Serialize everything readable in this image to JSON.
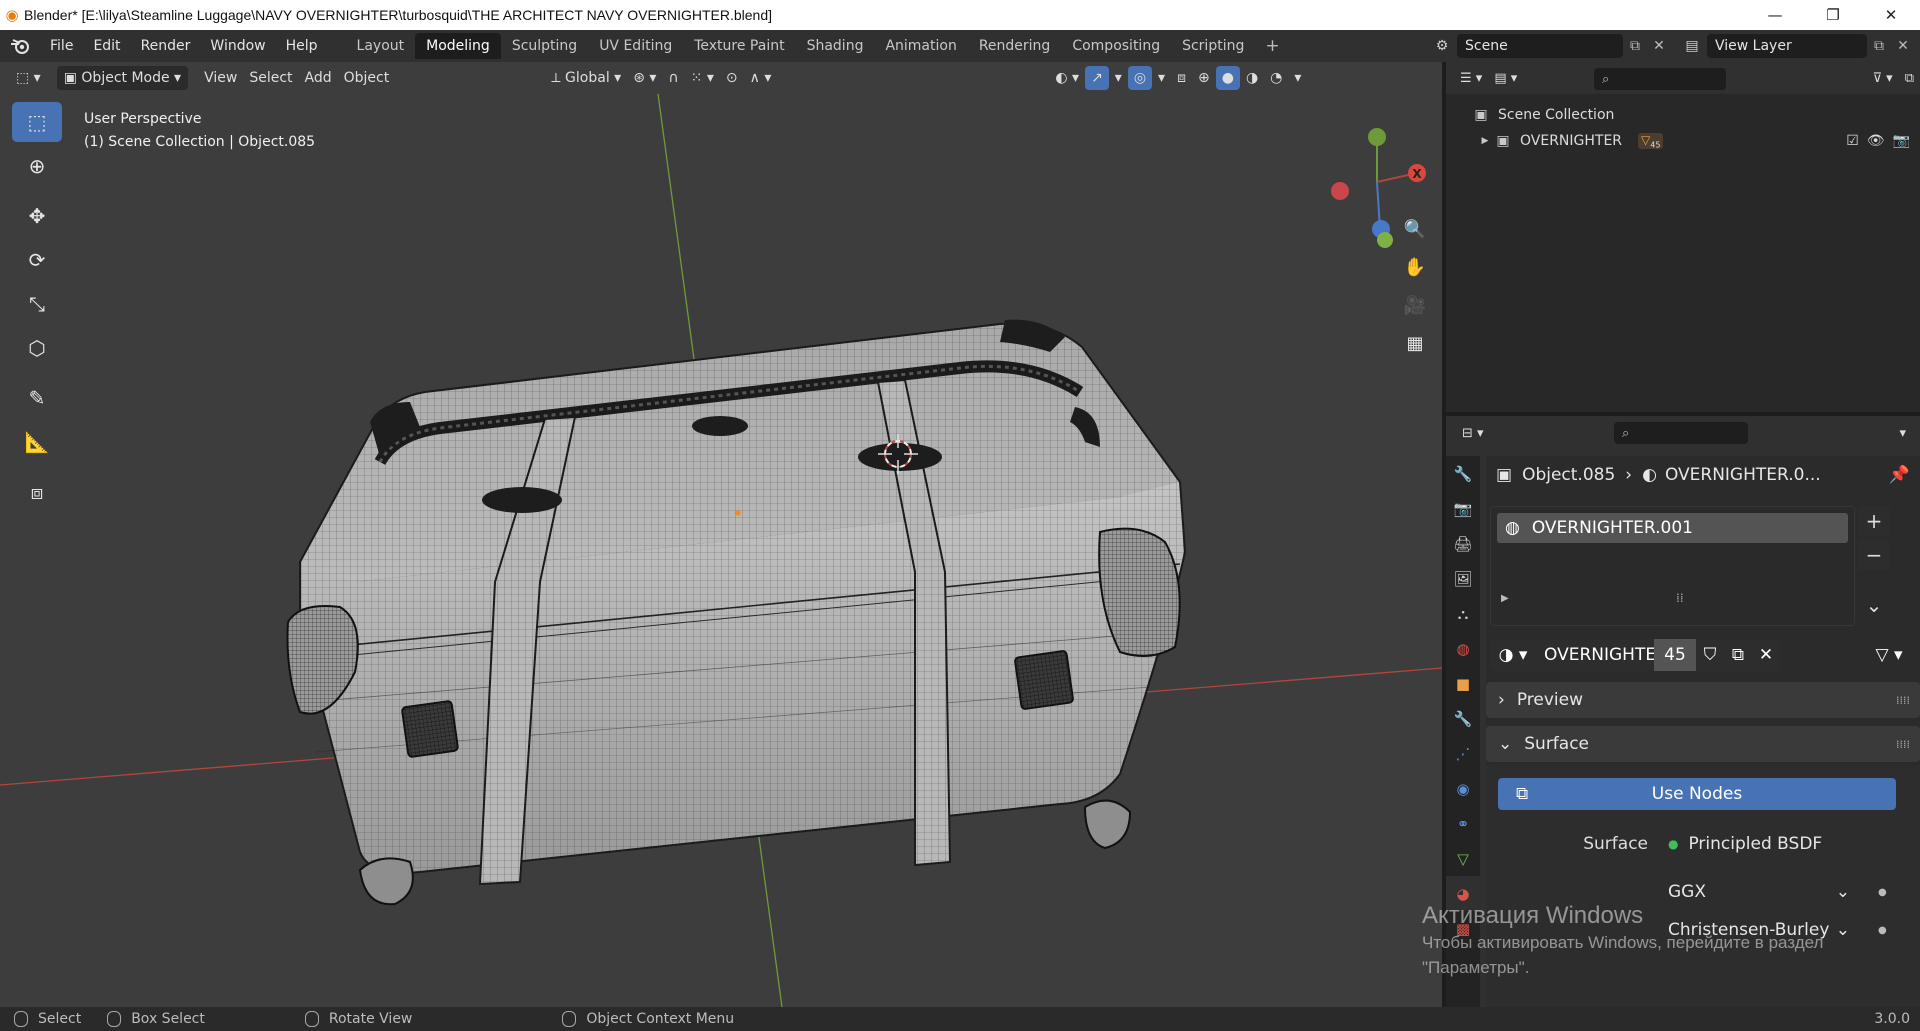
{
  "title_bar": {
    "title": "Blender* [E:\\lilya\\Steamline Luggage\\NAVY OVERNIGHTER\\turbosquid\\THE ARCHITECT NAVY OVERNIGHTER.blend]",
    "minimize": "—",
    "maximize": "❐",
    "close": "✕"
  },
  "menu": {
    "items": [
      "File",
      "Edit",
      "Render",
      "Window",
      "Help"
    ],
    "workspaces": [
      "Layout",
      "Modeling",
      "Sculpting",
      "UV Editing",
      "Texture Paint",
      "Shading",
      "Animation",
      "Rendering",
      "Compositing",
      "Scripting"
    ],
    "active_workspace": "Modeling",
    "add_workspace": "+",
    "scene": "Scene",
    "view_layer": "View Layer"
  },
  "viewport": {
    "mode": "Object Mode",
    "menus": [
      "View",
      "Select",
      "Add",
      "Object"
    ],
    "transform_orientation": "Global",
    "perspective_label": "User Perspective",
    "collection_label": "(1) Scene Collection | Object.085",
    "tools": [
      "select-box",
      "cursor",
      "move",
      "rotate",
      "scale",
      "transform",
      "annotate",
      "measure",
      "add-cube"
    ],
    "gizmo_axis_x": "X",
    "colors": {
      "background": "#3d3d3d",
      "x_axis": "#b0463f",
      "y_axis": "#6f9a3a",
      "mesh": "#bdbdbd",
      "wire": "#1e1e1e",
      "active_tool": "#4772b3"
    }
  },
  "outliner": {
    "root": "Scene Collection",
    "collection": "OVERNIGHTER",
    "collection_count": "45"
  },
  "properties": {
    "object_name": "Object.085",
    "material_crumb": "OVERNIGHTER.0...",
    "slot_name": "OVERNIGHTER.001",
    "material_field": "OVERNIGHTE...",
    "user_count": "45",
    "panels": {
      "preview": "Preview",
      "surface": "Surface"
    },
    "use_nodes": "Use Nodes",
    "surface_label": "Surface",
    "surface_value": "Principled BSDF",
    "distribution": "GGX",
    "subsurface_method": "Christensen-Burley"
  },
  "watermark": {
    "line1": "Активация Windows",
    "line2": "Чтобы активировать Windows, перейдите в раздел",
    "line3": "\"Параметры\"."
  },
  "status_bar": {
    "select": "Select",
    "box_select": "Box Select",
    "rotate_view": "Rotate View",
    "context_menu": "Object Context Menu",
    "version": "3.0.0"
  }
}
